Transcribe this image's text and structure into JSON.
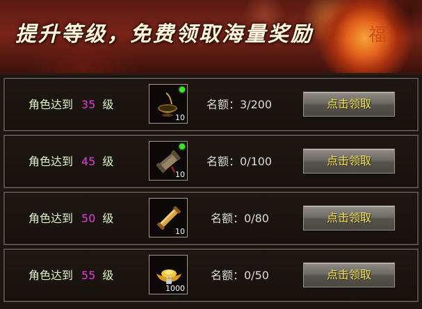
{
  "banner": {
    "title": "提升等级，免费领取海量奖励",
    "lantern_char": "福"
  },
  "rows": [
    {
      "prefix": "角色达到",
      "level": "35",
      "suffix": "级",
      "item_icon": "golden-bowl-icon",
      "item_count": "10",
      "has_dot": true,
      "quota": "名额：3/200",
      "button": "点击领取"
    },
    {
      "prefix": "角色达到",
      "level": "45",
      "suffix": "级",
      "item_icon": "scroll-bundle-icon",
      "item_count": "10",
      "has_dot": true,
      "quota": "名额：0/100",
      "button": "点击领取"
    },
    {
      "prefix": "角色达到",
      "level": "50",
      "suffix": "级",
      "item_icon": "scroll-icon",
      "item_count": "10",
      "has_dot": false,
      "quota": "名额：0/80",
      "button": "点击领取"
    },
    {
      "prefix": "角色达到",
      "level": "55",
      "suffix": "级",
      "item_icon": "gold-ingot-icon",
      "item_count": "1000",
      "has_dot": false,
      "quota": "名额：0/50",
      "button": "点击领取"
    }
  ],
  "colors": {
    "level": "#e33ad8",
    "label": "#dff5c4",
    "button_text": "#f3e35a"
  }
}
